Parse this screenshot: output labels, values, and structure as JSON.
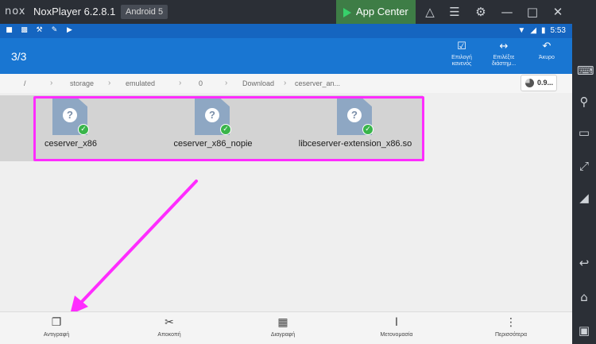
{
  "titlebar": {
    "logo": "nox",
    "title": "NoxPlayer 6.2.8.1",
    "android_version": "Android 5",
    "app_center_label": "App Center",
    "icons": [
      "shirt-icon",
      "menu-icon",
      "gear-icon",
      "minimize-icon",
      "maximize-icon",
      "close-icon"
    ]
  },
  "sidebar": {
    "icons": [
      "keyboard-icon",
      "location-icon",
      "screen-icon",
      "fullscreen-icon",
      "volume-icon",
      "back-icon",
      "home-icon",
      "recent-apps-icon"
    ]
  },
  "statusbar": {
    "time": "5:53",
    "icons": [
      "screen-icon",
      "monitor-icon",
      "wrench-icon",
      "pen-icon",
      "play-icon",
      "wifi-icon",
      "signal-icon",
      "battery-icon"
    ]
  },
  "appbar": {
    "selection_count": "3/3",
    "actions": [
      {
        "name": "select-all",
        "label": "Επιλογή κανενός",
        "icon": "checkbox-icon"
      },
      {
        "name": "select-range",
        "label": "Επιλέξτε διάστημ...",
        "icon": "range-icon"
      },
      {
        "name": "cancel",
        "label": "Άκυρο",
        "icon": "undo-icon"
      }
    ]
  },
  "breadcrumb": {
    "parts": [
      "/",
      "storage",
      "emulated",
      "0",
      "Download",
      "ceserver_an..."
    ],
    "storage_indicator": "0.9..."
  },
  "files": [
    {
      "name": "ceserver_x86",
      "selected": true
    },
    {
      "name": "ceserver_x86_nopie",
      "selected": true
    },
    {
      "name": "libceserver-extension_x86.so",
      "selected": true
    }
  ],
  "bottombar": {
    "items": [
      {
        "name": "copy",
        "label": "Αντιγραφή",
        "icon": "copy-icon"
      },
      {
        "name": "cut",
        "label": "Αποκοπή",
        "icon": "scissors-icon"
      },
      {
        "name": "delete",
        "label": "Διαγραφή",
        "icon": "trash-icon"
      },
      {
        "name": "rename",
        "label": "Μετονομασία",
        "icon": "text-cursor-icon"
      },
      {
        "name": "more",
        "label": "Περισσότερα",
        "icon": "more-vertical-icon"
      }
    ]
  },
  "colors": {
    "appbar": "#1976d2",
    "statusbar": "#1565c0",
    "highlight": "#ff2cff",
    "app_center": "#3e7d46",
    "check": "#39b54a"
  }
}
